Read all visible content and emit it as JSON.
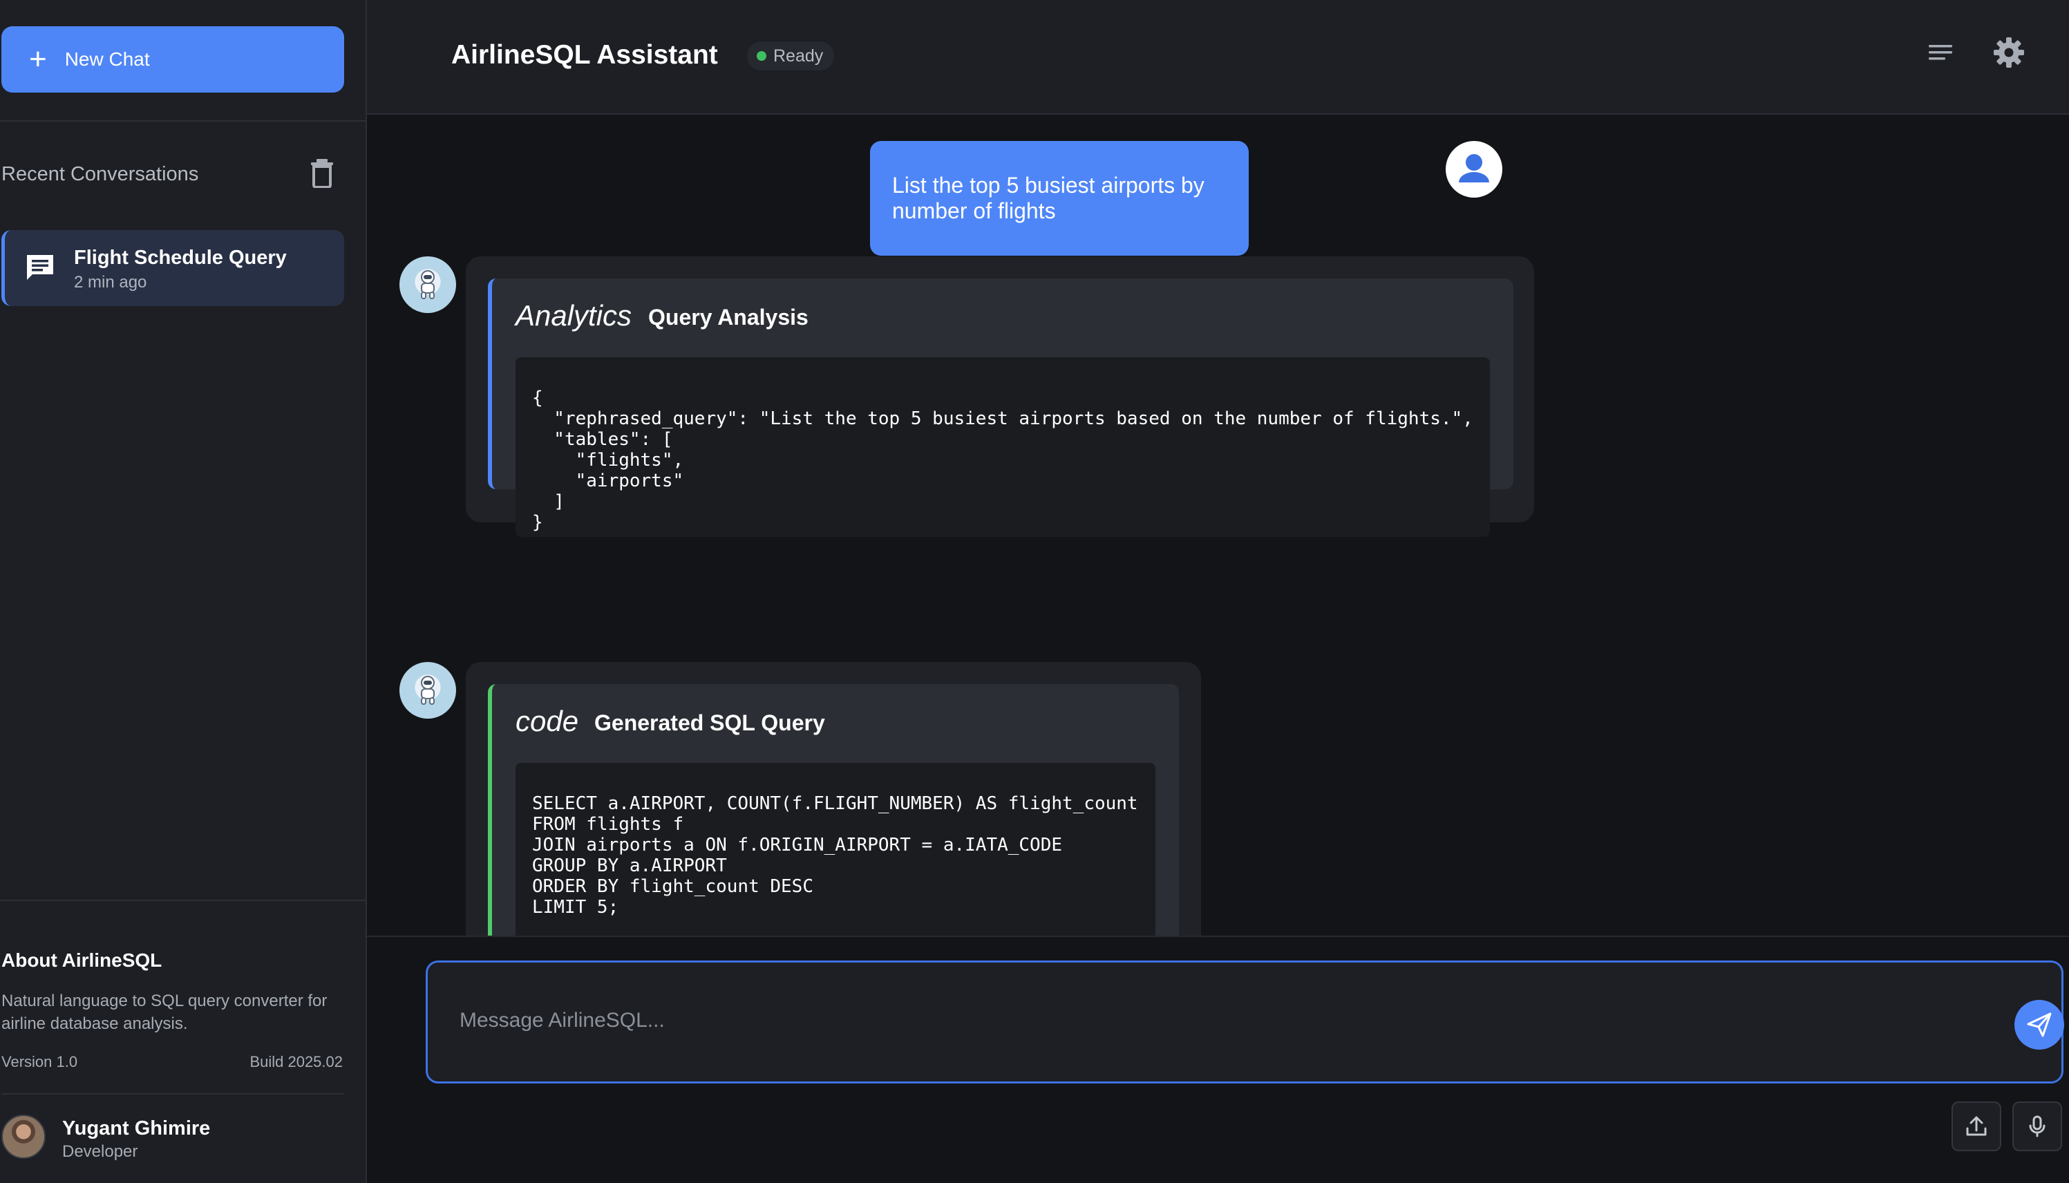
{
  "sidebar": {
    "new_chat_label": "New Chat",
    "recent_title": "Recent Conversations",
    "conversations": [
      {
        "title": "Flight Schedule Query",
        "time": "2 min ago"
      }
    ],
    "about": {
      "title": "About AirlineSQL",
      "description": "Natural language to SQL query converter for airline database analysis.",
      "version": "Version 1.0",
      "build": "Build 2025.02"
    },
    "user": {
      "name": "Yugant Ghimire",
      "role": "Developer"
    }
  },
  "header": {
    "title": "AirlineSQL Assistant",
    "status": "Ready",
    "status_color": "#3fbf5f"
  },
  "chat": {
    "user_message": "List the top 5 busiest airports by number of flights",
    "analysis_card": {
      "icon_text": "Analytics",
      "title": "Query Analysis",
      "code": "{\n  \"rephrased_query\": \"List the top 5 busiest airports based on the number of flights.\",\n  \"tables\": [\n    \"flights\",\n    \"airports\"\n  ]\n}"
    },
    "sql_card": {
      "icon_text": "code",
      "title": "Generated SQL Query",
      "code": "SELECT a.AIRPORT, COUNT(f.FLIGHT_NUMBER) AS flight_count\nFROM flights f\nJOIN airports a ON f.ORIGIN_AIRPORT = a.IATA_CODE\nGROUP BY a.AIRPORT\nORDER BY flight_count DESC\nLIMIT 5;"
    }
  },
  "input": {
    "placeholder": "Message AirlineSQL..."
  },
  "colors": {
    "accent": "#4f86f7",
    "success": "#53c96b",
    "background": "#131418",
    "panel": "#1d1f24"
  }
}
